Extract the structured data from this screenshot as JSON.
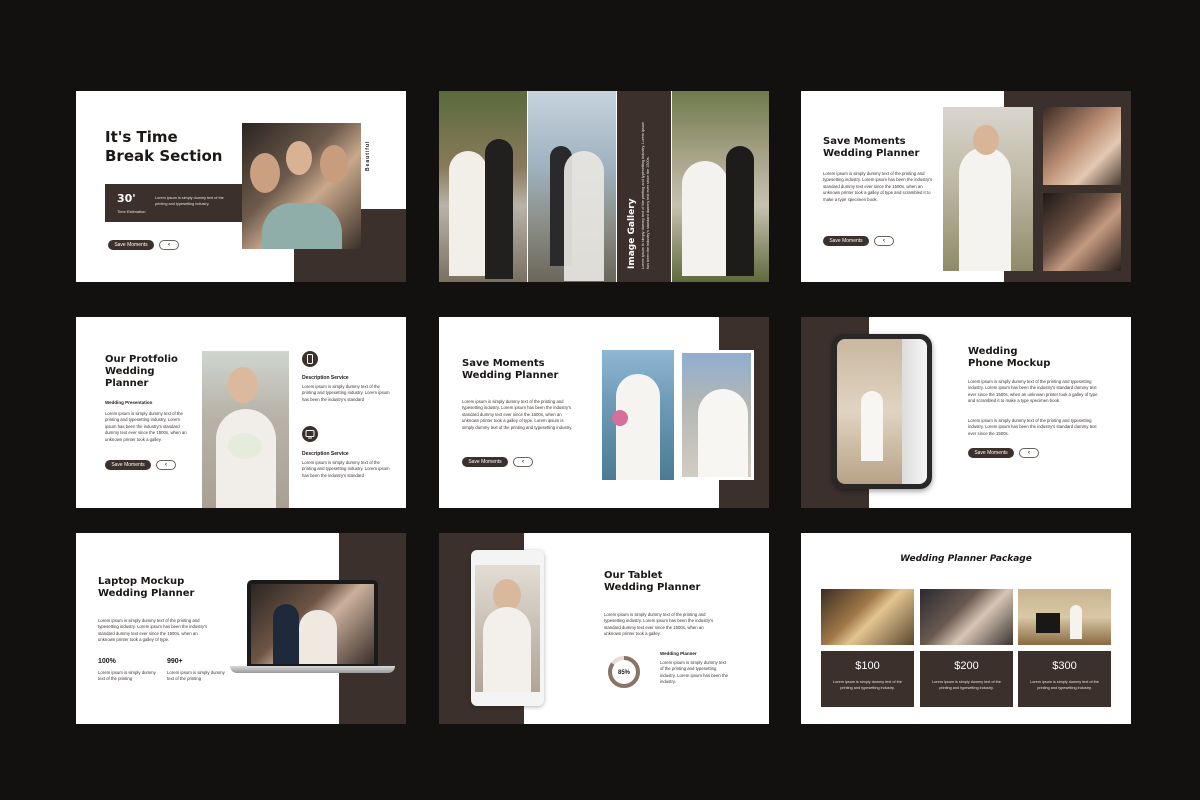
{
  "colors": {
    "background": "#121110",
    "accent": "#3b302c",
    "slide": "#ffffff"
  },
  "common": {
    "button_label": "Save Moments",
    "arrow_icon": "‹",
    "lorem": "Lorem ipsum is simply dummy text of the printing and typesetting industry. Lorem ipsum has been the industry's standard dummy text ever since the 1500s, when an unknown printer took a galley of type."
  },
  "s1": {
    "title": "It's Time\nBreak Section",
    "stat_value": "30'",
    "stat_label": "Time Estimation",
    "stat_text": "Lorem ipsum is simply dummy text of the printing and typesetting industry.",
    "vertical_word": "Beautiful"
  },
  "s2": {
    "title": "Image Gallery",
    "text": "Lorem ipsum is simply dummy text of the printing and typesetting industry. Lorem ipsum has been the industry's standard dummy text ever since the 1500s."
  },
  "s3": {
    "title": "Save Moments\nWedding Planner",
    "text": "Lorem ipsum is simply dummy text of the printing and typesetting industry. Lorem ipsum has been the industry's standard dummy text ever since the 1500s, when an unknown printer took a galley of type and scrambled it to make a type specimen book."
  },
  "s4": {
    "title": "Our Protfolio\nWedding\nPlanner",
    "subtitle": "Wedding Presentation",
    "text": "Lorem ipsum is simply dummy text of the printing and typesetting industry. Lorem ipsum has been the industry's standard dummy text ever since the 1500s, when an unknown printer took a galley.",
    "service1_title": "Description Service",
    "service1_text": "Lorem ipsum is simply dummy text of the printing and typesetting industry. Lorem ipsum has been the industry's standard",
    "service2_title": "Description Service",
    "service2_text": "Lorem ipsum is simply dummy text of the printing and typesetting industry. Lorem ipsum has been the industry's standard"
  },
  "s5": {
    "title": "Save Moments\nWedding Planner",
    "text": "Lorem ipsum is simply dummy text of the printing and typesetting industry. Lorem ipsum has been the industry's standard dummy text ever since the 1500s, when an unknown printer took a galley of type. Lorem ipsum is simply dummy text of the printing and typesetting industry."
  },
  "s6": {
    "title": "Wedding\nPhone Mockup",
    "text1": "Lorem ipsum is simply dummy text of the printing and typesetting industry. Lorem ipsum has been the industry's standard dummy text ever since the 1500s, when an unknown printer took a galley of type and scrambled it to make a type specimen book.",
    "text2": "Lorem ipsum is simply dummy text of the printing and typesetting industry. Lorem ipsum has been the industry's standard dummy text ever since the 1500s."
  },
  "s7": {
    "title": "Laptop Mockup\nWedding Planner",
    "text": "Lorem ipsum is simply dummy text of the printing and typesetting industry. Lorem ipsum has been the industry's standard dummy text ever since the 1500s, when an unknown printer took a galley of type.",
    "stat1_value": "100%",
    "stat1_text": "Lorem ipsum is simply dummy text of the printing",
    "stat2_value": "990+",
    "stat2_text": "Lorem ipsum is simply dummy text of the printing"
  },
  "s8": {
    "title": "Our Tablet\nWedding Planner",
    "text": "Lorem ipsum is simply dummy text of the printing and typesetting industry. Lorem ipsum has been the industry's standard dummy text ever since the 1500s, when an unknown printer took a galley.",
    "progress_label": "85%",
    "progress_value": 0.85,
    "progress_title": "Wedding Planner",
    "progress_text": "Lorem ipsum is simply dummy text of the printing and typesetting industry. Lorem ipsum has been the industry."
  },
  "s9": {
    "title": "Wedding Planner Package",
    "prices": [
      {
        "price": "$100",
        "text": "Lorem ipsum is simply dummy text of the printing and typesetting industry."
      },
      {
        "price": "$200",
        "text": "Lorem ipsum is simply dummy text of the printing and typesetting industry."
      },
      {
        "price": "$300",
        "text": "Lorem ipsum is simply dummy text of the printing and typesetting industry."
      }
    ]
  }
}
